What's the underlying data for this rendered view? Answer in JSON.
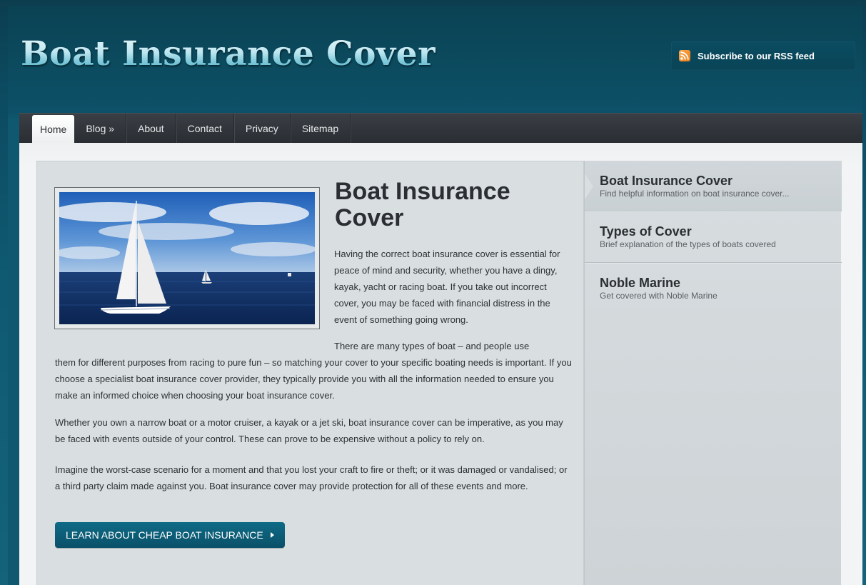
{
  "site": {
    "logo_text": "Boat Insurance Cover"
  },
  "rss": {
    "label": "Subscribe to our RSS feed",
    "icon": "rss-icon"
  },
  "nav": {
    "items": [
      {
        "label": "Home",
        "active": true
      },
      {
        "label": "Blog »"
      },
      {
        "label": "About"
      },
      {
        "label": "Contact"
      },
      {
        "label": "Privacy"
      },
      {
        "label": "Sitemap"
      }
    ]
  },
  "main": {
    "image": "sailboat-photo",
    "title": "Boat Insurance Cover",
    "paragraphs": [
      "Having the correct boat insurance cover is essential for peace of mind and security, whether you have a dingy, kayak, yacht or racing boat. If you take out incorrect cover, you may be faced with financial distress in the event of something going wrong.",
      "There are many types of boat – and people use",
      "them for different purposes from racing to pure fun – so matching your cover to your specific boating needs is important. If you choose a specialist boat insurance cover provider, they typically provide you with all the information needed to ensure you make an informed choice when choosing your boat insurance cover.",
      "Whether you own a narrow boat or a motor cruiser, a kayak or a jet ski, boat insurance cover can be imperative, as you may be faced with events outside of your control. These can prove to be expensive without a policy to rely on.",
      "Imagine the worst-case scenario for a moment and that you lost your craft to fire or theft; or it was damaged or vandalised; or a third party claim made against you. Boat insurance cover may provide protection for all of these events and more."
    ],
    "cta_label": "LEARN ABOUT CHEAP BOAT INSURANCE"
  },
  "sidebar": {
    "items": [
      {
        "title": "Boat Insurance Cover",
        "desc": "Find helpful information on boat insurance cover...",
        "active": true
      },
      {
        "title": "Types of Cover",
        "desc": "Brief explanation of the types of boats covered"
      },
      {
        "title": "Noble Marine",
        "desc": "Get covered with Noble Marine"
      }
    ]
  },
  "colors": {
    "background": "#0f5870",
    "nav_bar": "#2f3439",
    "button": "#0a5f79",
    "panel": "#d9dfe1"
  }
}
